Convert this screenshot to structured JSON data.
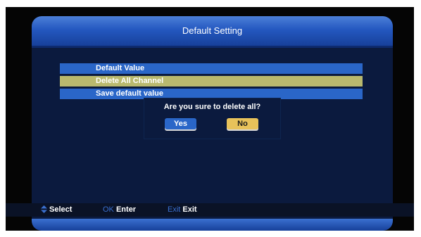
{
  "header": {
    "title": "Default Setting"
  },
  "menu": {
    "items": [
      {
        "label": "Default Value"
      },
      {
        "label": "Delete All Channel"
      },
      {
        "label": "Save default value"
      }
    ]
  },
  "dialog": {
    "message": "Are you sure to delete all?",
    "yes_label": "Yes",
    "no_label": "No"
  },
  "footer": {
    "select_label": "Select",
    "ok_key": "OK",
    "ok_label": "Enter",
    "exit_key": "Exit",
    "exit_label": "Exit"
  },
  "colors": {
    "accent_blue": "#2a66c8",
    "selected_item": "#b9b96e",
    "no_button": "#e8c25a",
    "key_ok": "#3a70d0",
    "key_exit": "#3a70d0"
  }
}
